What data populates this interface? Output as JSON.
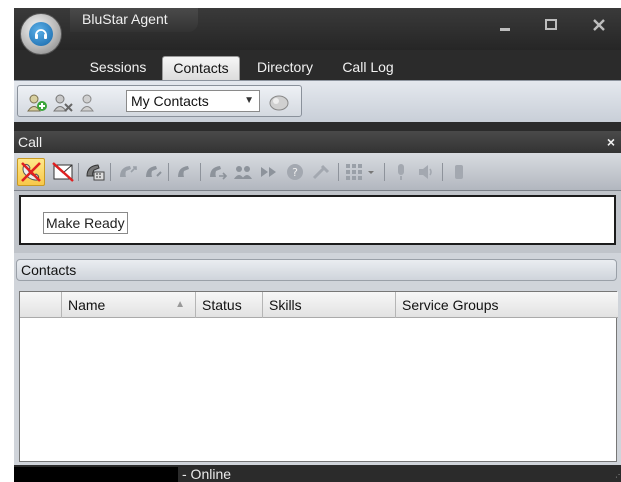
{
  "window": {
    "title": "BluStar Agent",
    "minimize_label": "_",
    "maximize_label": "□",
    "close_label": "X"
  },
  "tabs": [
    {
      "label": "Sessions",
      "active": false
    },
    {
      "label": "Contacts",
      "active": true
    },
    {
      "label": "Directory",
      "active": false
    },
    {
      "label": "Call Log",
      "active": false
    }
  ],
  "contacts_toolbar": {
    "icons": [
      "add-contact-icon",
      "remove-contact-icon",
      "contact-properties-icon",
      "contacts-list-icon"
    ],
    "selected_list": "My Contacts"
  },
  "call_panel": {
    "title": "Call",
    "close_label": "×",
    "toolbar_icons": [
      "not-ready-icon",
      "no-mail-icon",
      "dial-pad-icon",
      "answer-icon",
      "hold-icon",
      "transfer-icon",
      "conference-icon",
      "forward-icon",
      "help-icon",
      "settings-icon",
      "keypad-icon",
      "microphone-icon",
      "speaker-icon",
      "recording-icon"
    ],
    "make_ready_label": "Make Ready"
  },
  "contacts_panel": {
    "title": "Contacts",
    "columns": [
      "",
      "Name",
      "Status",
      "Skills",
      "Service Groups"
    ],
    "rows": []
  },
  "status_bar": {
    "status_text": "- Online"
  },
  "colors": {
    "chrome_dark": "#2b2b2b",
    "toolbar_light": "#e4e8ee",
    "active_tab": "#f6f6f6",
    "not_ready_highlight": "#f8c84a",
    "not_ready_icon": "#e02020"
  }
}
